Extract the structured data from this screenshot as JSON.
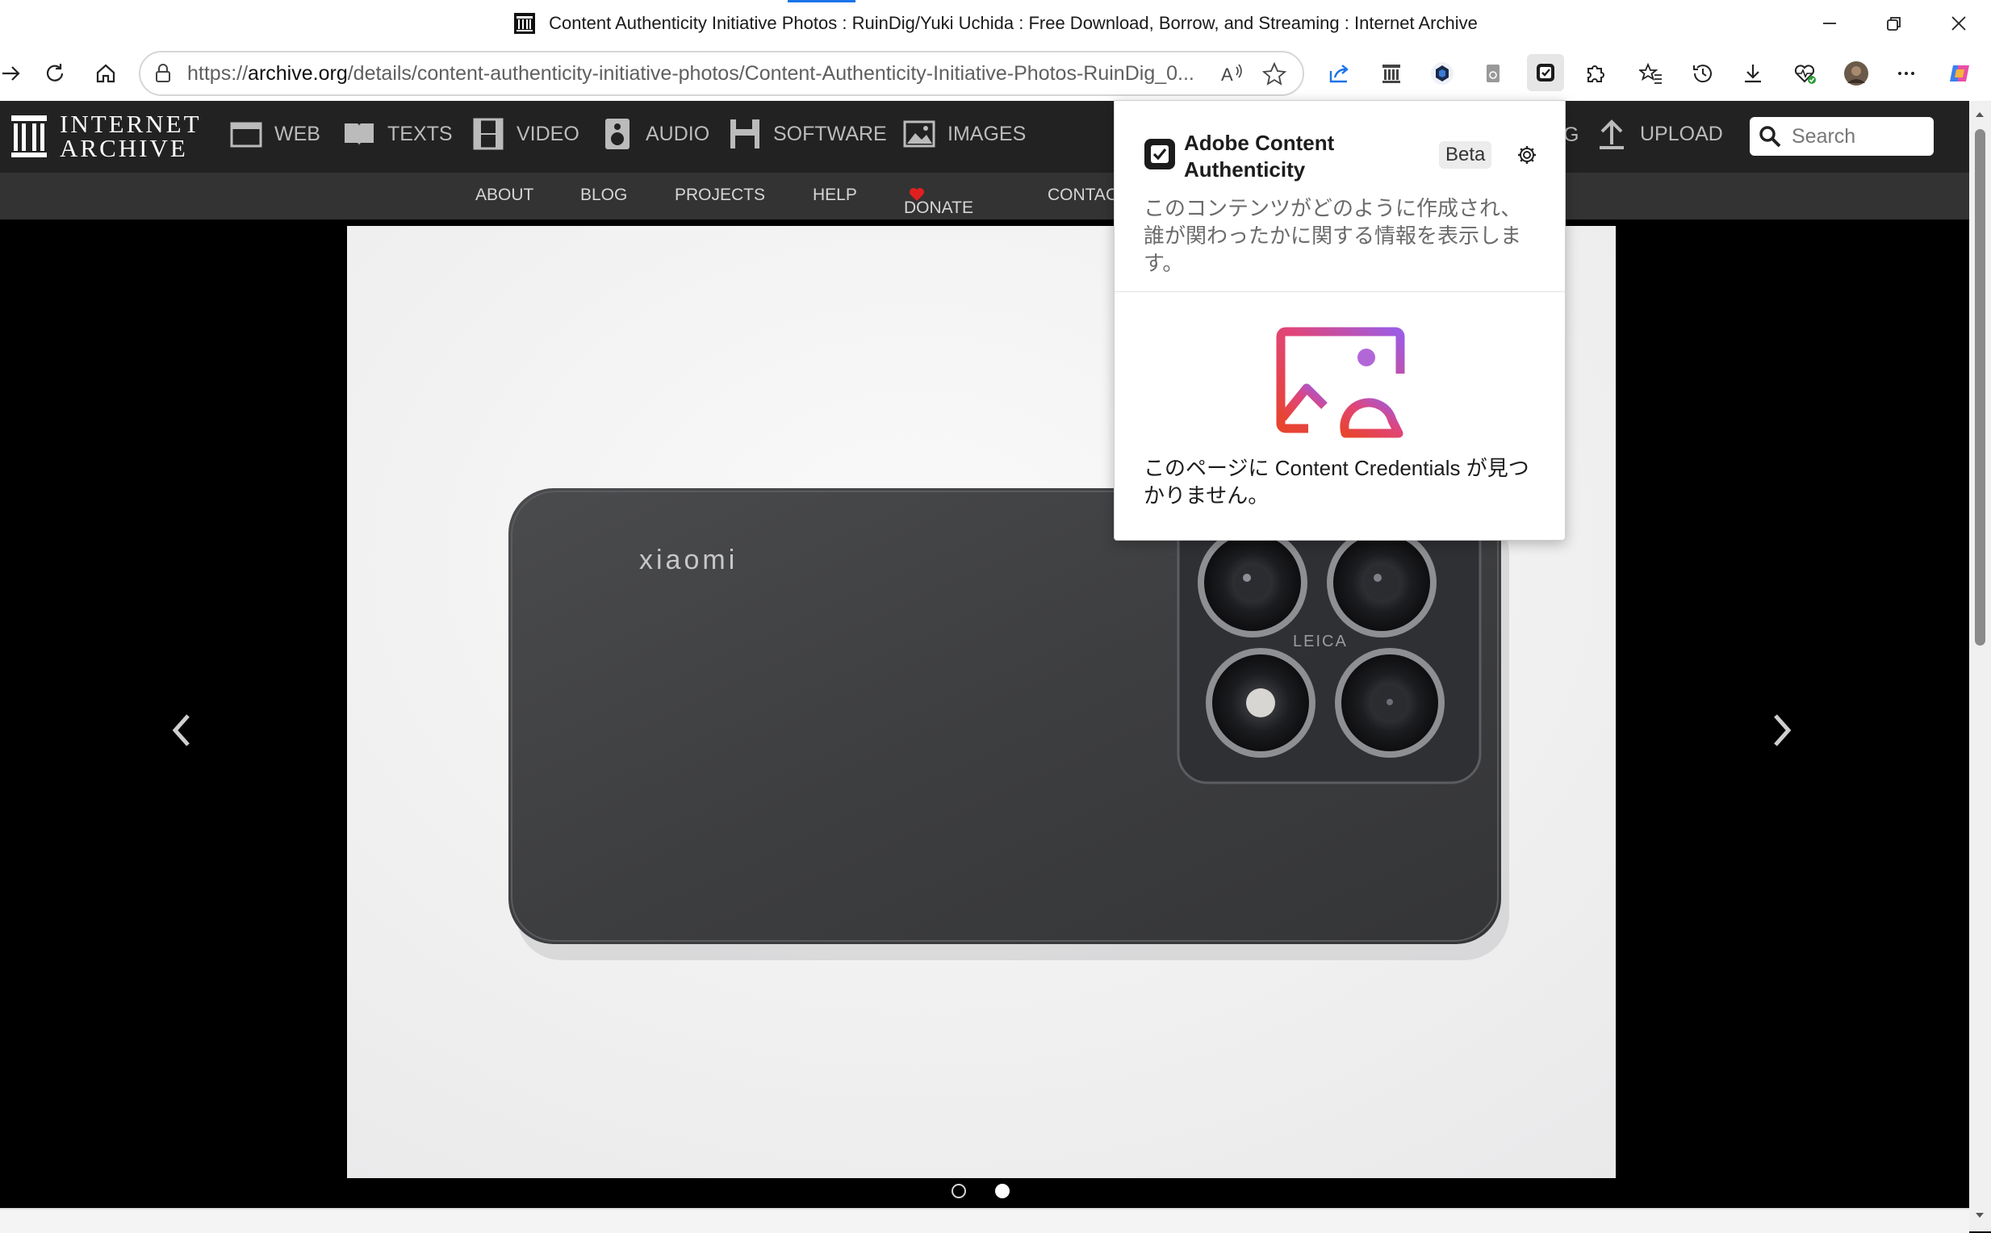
{
  "window": {
    "title": "Content Authenticity Initiative Photos : RuinDig/Yuki Uchida : Free Download, Borrow, and Streaming : Internet Archive"
  },
  "address_bar": {
    "url_prefix": "https://",
    "url_domain": "archive.org",
    "url_path": "/details/content-authenticity-initiative-photos/Content-Authenticity-Initiative-Photos-RuinDig_0..."
  },
  "site": {
    "logo_line1": "INTERNET",
    "logo_line2": "ARCHIVE",
    "media_nav": [
      "WEB",
      "TEXTS",
      "VIDEO",
      "AUDIO",
      "SOFTWARE",
      "IMAGES"
    ],
    "partial_label": "G",
    "upload_label": "UPLOAD",
    "search_placeholder": "Search",
    "sub_nav": [
      "ABOUT",
      "BLOG",
      "PROJECTS",
      "HELP",
      "DONATE",
      "CONTAC"
    ]
  },
  "photo": {
    "phone_brand": "xiaomi",
    "lens_brand": "LEICA",
    "dots_total": 2,
    "dot_active_index": 1
  },
  "popup": {
    "title": "Adobe Content Authenticity",
    "badge": "Beta",
    "description": "このコンテンツがどのように作成され、誰が関わったかに関する情報を表示します。",
    "empty_message": "このページに Content Credentials が見つかりません。"
  },
  "colors": {
    "ia_nav_bg": "#222222",
    "ia_subnav_bg": "#333333",
    "donate_heart": "#e02020",
    "accent_blue": "#1a73e8",
    "cai_gradient_start": "#e03a3a",
    "cai_gradient_end": "#9b5de5"
  }
}
